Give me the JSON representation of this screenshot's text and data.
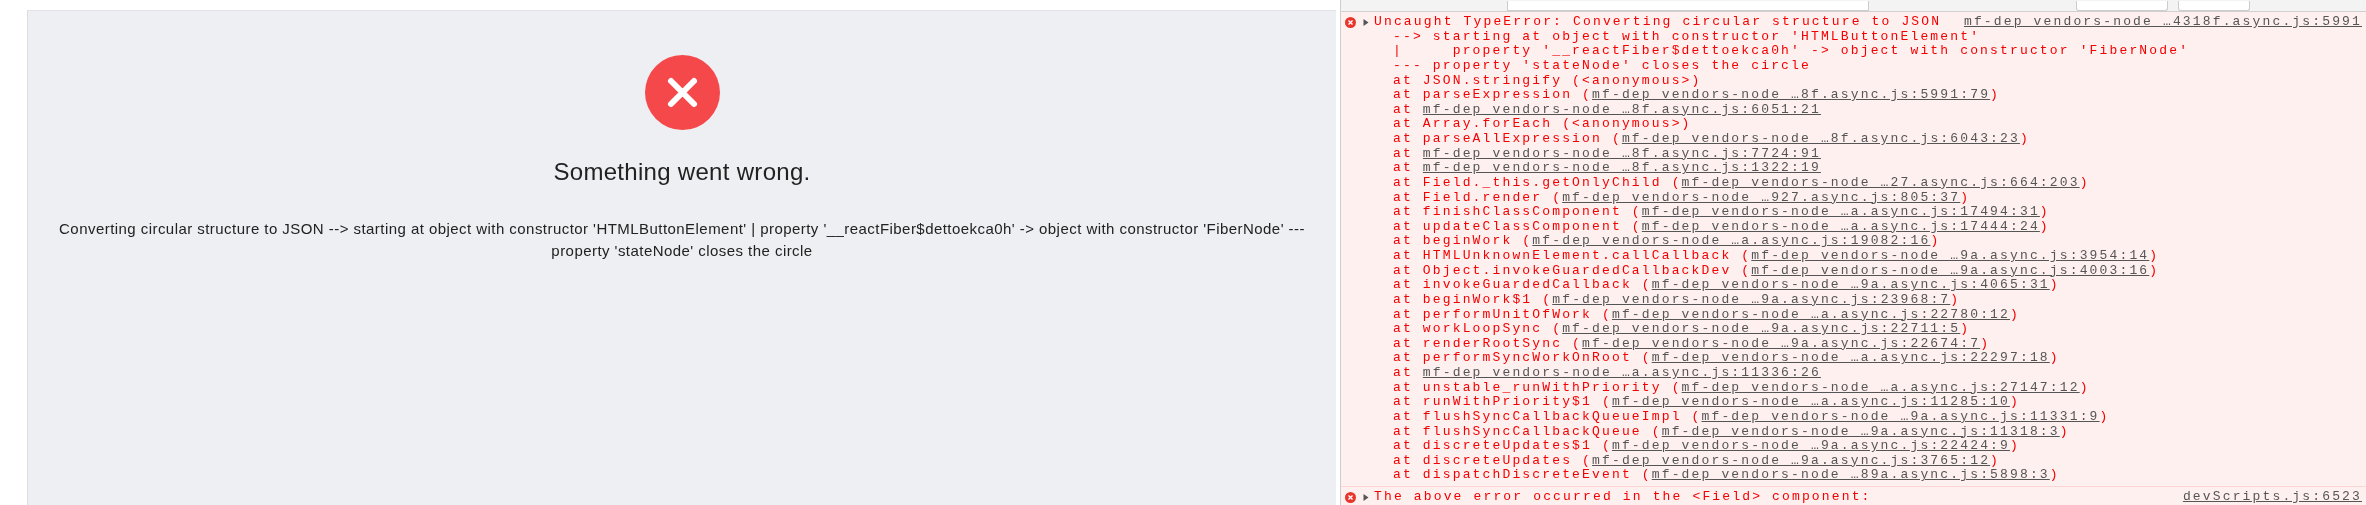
{
  "error_page": {
    "title": "Something went wrong.",
    "message": "Converting circular structure to JSON --> starting at object with constructor 'HTMLButtonElement' | property '__reactFiber$dettoekca0h' -> object with constructor 'FiberNode' --- property 'stateNode' closes the circle"
  },
  "console": {
    "messages": [
      {
        "kind": "error",
        "expanded": false,
        "text": "Uncaught TypeError: Converting circular structure to JSON",
        "source": "mf-dep_vendors-node_…4318f.async.js:5991",
        "details": [
          "--> starting at object with constructor 'HTMLButtonElement'",
          "|     property '__reactFiber$dettoekca0h' -> object with constructor 'FiberNode'",
          "--- property 'stateNode' closes the circle"
        ],
        "stack": [
          {
            "prefix": "at JSON.stringify (<anonymous>)"
          },
          {
            "prefix": "at parseExpression (",
            "link": "mf-dep_vendors-node_…8f.async.js:5991:79",
            "suffix": ")"
          },
          {
            "prefix": "at ",
            "link": "mf-dep_vendors-node_…8f.async.js:6051:21"
          },
          {
            "prefix": "at Array.forEach (<anonymous>)"
          },
          {
            "prefix": "at parseAllExpression (",
            "link": "mf-dep_vendors-node_…8f.async.js:6043:23",
            "suffix": ")"
          },
          {
            "prefix": "at ",
            "link": "mf-dep_vendors-node_…8f.async.js:7724:91"
          },
          {
            "prefix": "at ",
            "link": "mf-dep_vendors-node_…8f.async.js:1322:19"
          },
          {
            "prefix": "at Field._this.getOnlyChild (",
            "link": "mf-dep_vendors-node_…27.async.js:664:203",
            "suffix": ")"
          },
          {
            "prefix": "at Field.render (",
            "link": "mf-dep_vendors-node_…927.async.js:805:37",
            "suffix": ")"
          },
          {
            "prefix": "at finishClassComponent (",
            "link": "mf-dep_vendors-node_…a.async.js:17494:31",
            "suffix": ")"
          },
          {
            "prefix": "at updateClassComponent (",
            "link": "mf-dep_vendors-node_…a.async.js:17444:24",
            "suffix": ")"
          },
          {
            "prefix": "at beginWork (",
            "link": "mf-dep_vendors-node_…a.async.js:19082:16",
            "suffix": ")"
          },
          {
            "prefix": "at HTMLUnknownElement.callCallback (",
            "link": "mf-dep_vendors-node_…9a.async.js:3954:14",
            "suffix": ")"
          },
          {
            "prefix": "at Object.invokeGuardedCallbackDev (",
            "link": "mf-dep_vendors-node_…9a.async.js:4003:16",
            "suffix": ")"
          },
          {
            "prefix": "at invokeGuardedCallback (",
            "link": "mf-dep_vendors-node_…9a.async.js:4065:31",
            "suffix": ")"
          },
          {
            "prefix": "at beginWork$1 (",
            "link": "mf-dep_vendors-node_…9a.async.js:23968:7",
            "suffix": ")"
          },
          {
            "prefix": "at performUnitOfWork (",
            "link": "mf-dep_vendors-node_…a.async.js:22780:12",
            "suffix": ")"
          },
          {
            "prefix": "at workLoopSync (",
            "link": "mf-dep_vendors-node_…9a.async.js:22711:5",
            "suffix": ")"
          },
          {
            "prefix": "at renderRootSync (",
            "link": "mf-dep_vendors-node_…9a.async.js:22674:7",
            "suffix": ")"
          },
          {
            "prefix": "at performSyncWorkOnRoot (",
            "link": "mf-dep_vendors-node_…a.async.js:22297:18",
            "suffix": ")"
          },
          {
            "prefix": "at ",
            "link": "mf-dep_vendors-node_…a.async.js:11336:26"
          },
          {
            "prefix": "at unstable_runWithPriority (",
            "link": "mf-dep_vendors-node_…a.async.js:27147:12",
            "suffix": ")"
          },
          {
            "prefix": "at runWithPriority$1 (",
            "link": "mf-dep_vendors-node_…a.async.js:11285:10",
            "suffix": ")"
          },
          {
            "prefix": "at flushSyncCallbackQueueImpl (",
            "link": "mf-dep_vendors-node_…9a.async.js:11331:9",
            "suffix": ")"
          },
          {
            "prefix": "at flushSyncCallbackQueue (",
            "link": "mf-dep_vendors-node_…9a.async.js:11318:3",
            "suffix": ")"
          },
          {
            "prefix": "at discreteUpdates$1 (",
            "link": "mf-dep_vendors-node_…9a.async.js:22424:9",
            "suffix": ")"
          },
          {
            "prefix": "at discreteUpdates (",
            "link": "mf-dep_vendors-node_…9a.async.js:3765:12",
            "suffix": ")"
          },
          {
            "prefix": "at dispatchDiscreteEvent (",
            "link": "mf-dep_vendors-node_…89a.async.js:5898:3",
            "suffix": ")"
          }
        ]
      },
      {
        "kind": "error",
        "expanded": false,
        "text": "The above error occurred in the <Field> component:",
        "source": "devScripts.js:6523"
      }
    ]
  }
}
